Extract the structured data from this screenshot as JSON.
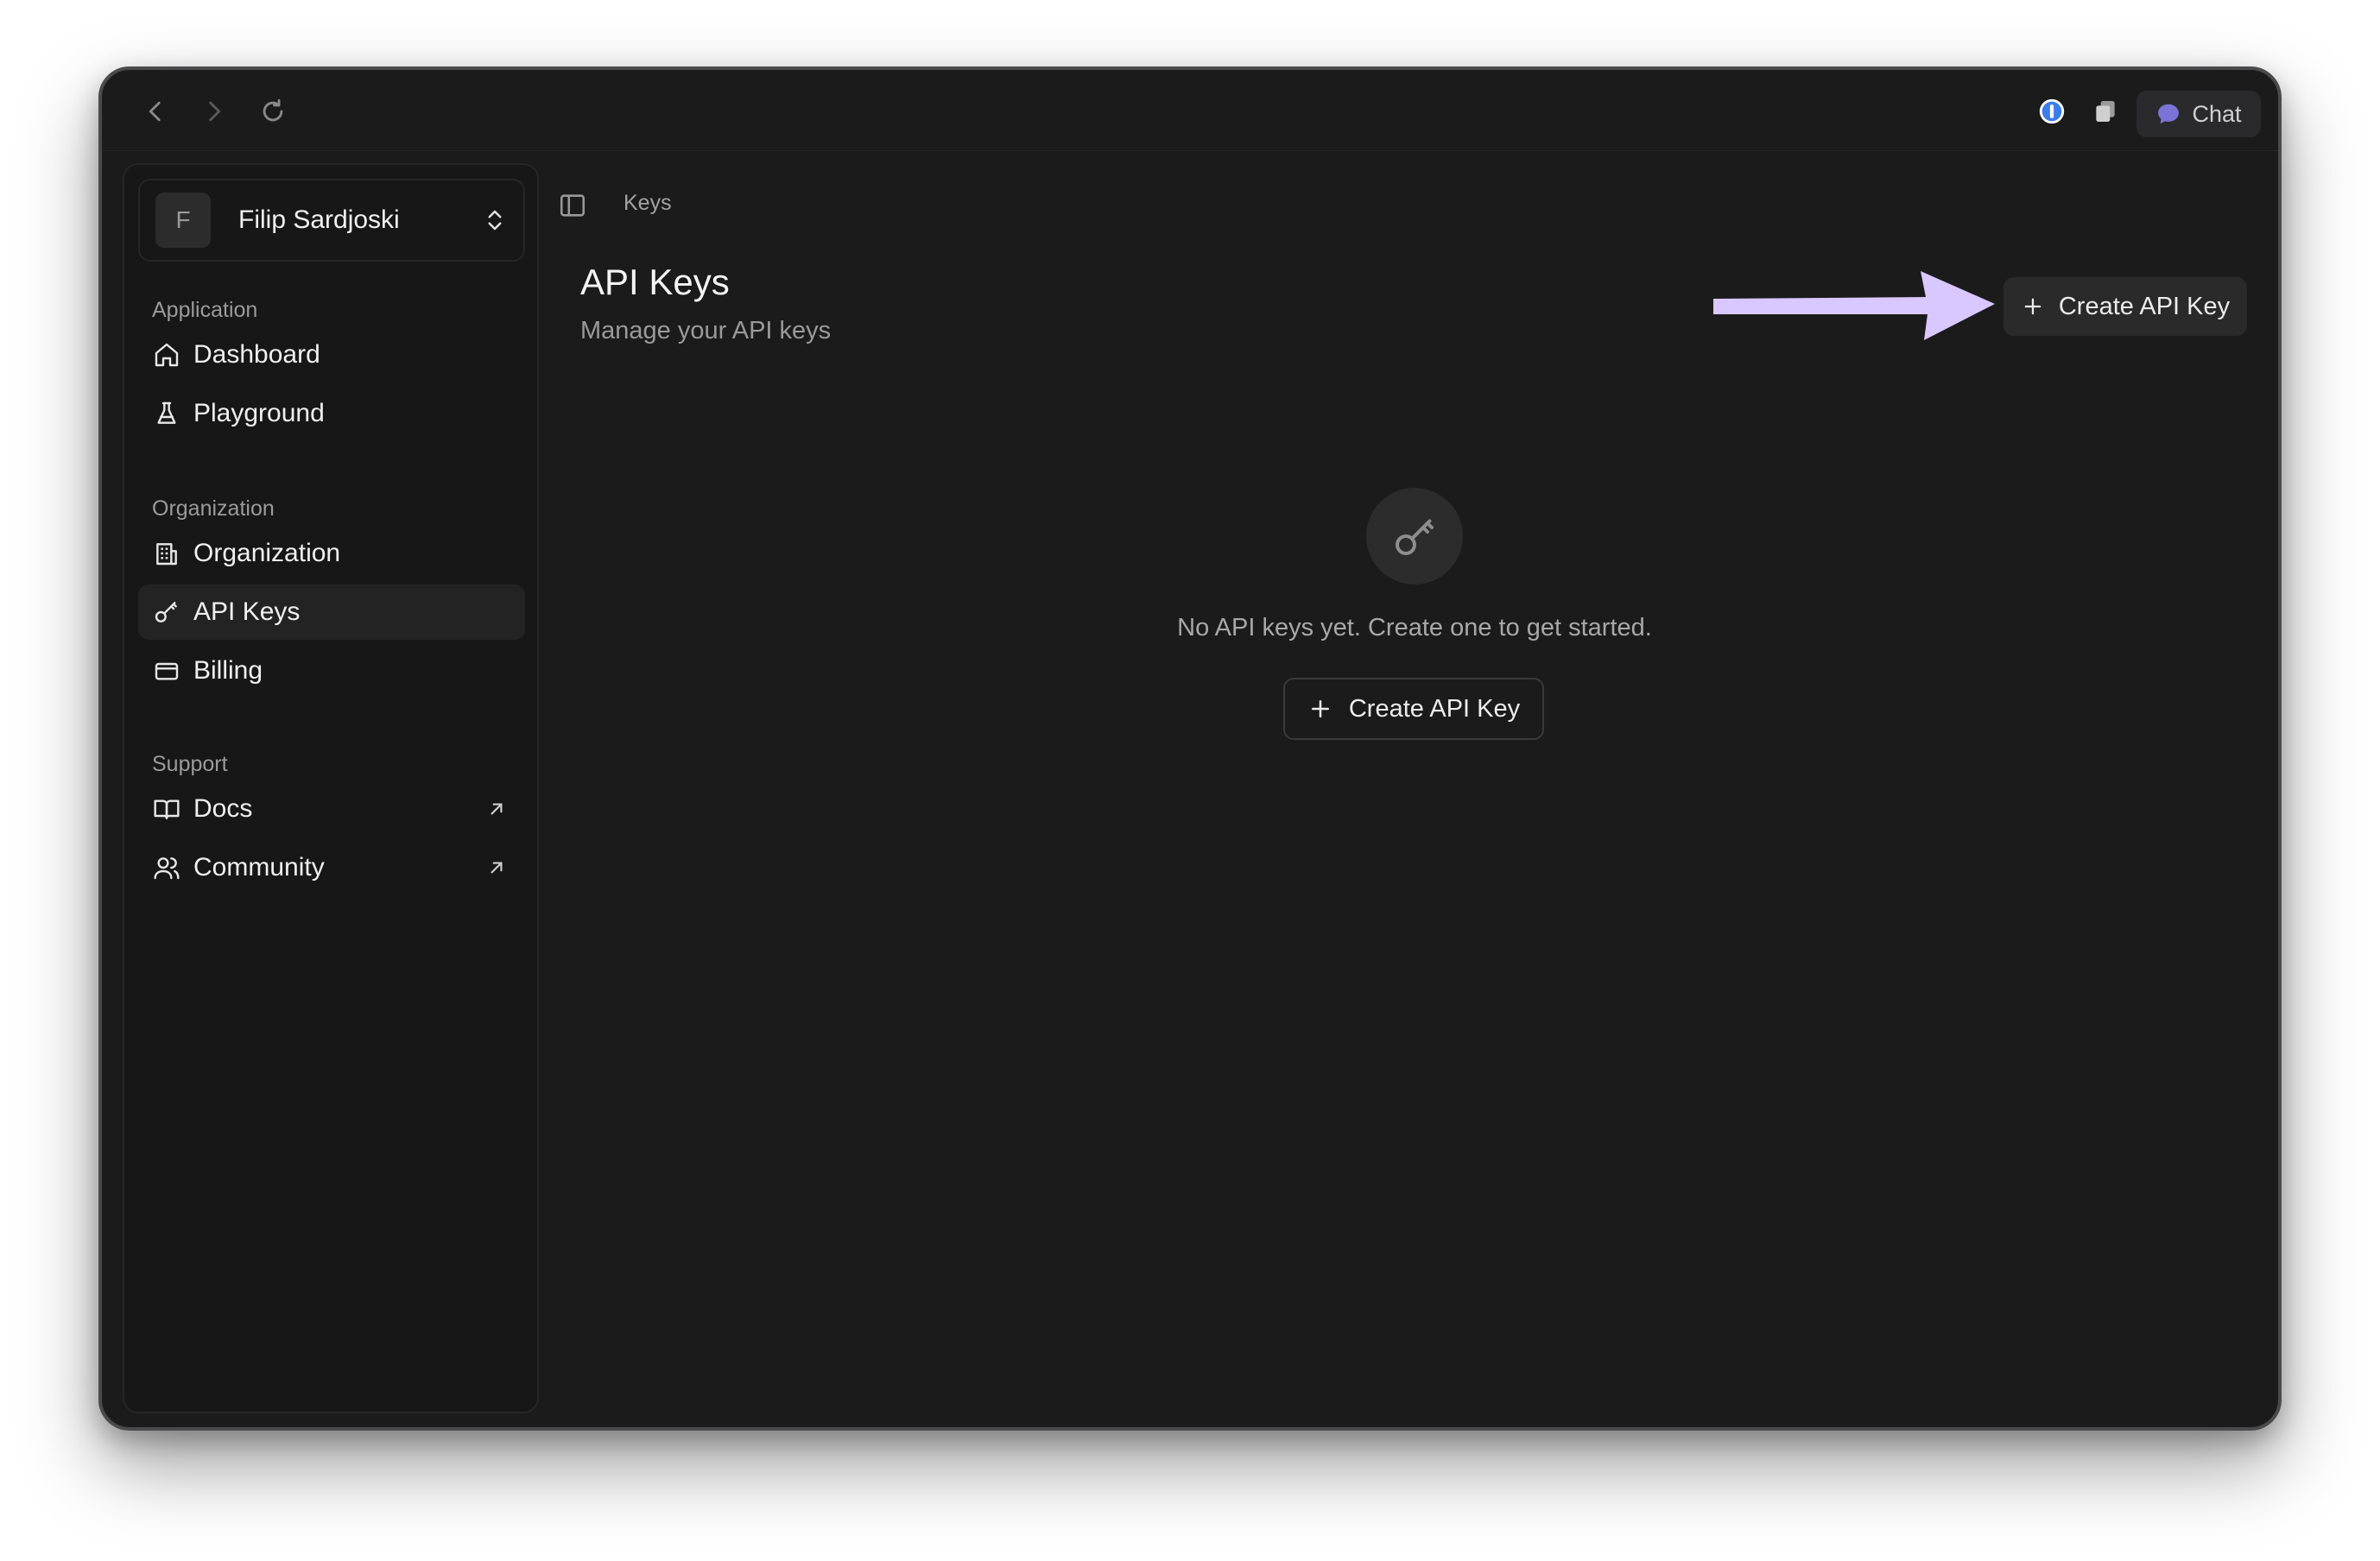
{
  "topbar": {
    "chat_label": "Chat",
    "icons": [
      "back-arrow-icon",
      "forward-arrow-icon",
      "reload-icon",
      "password-manager-icon",
      "copy-icon",
      "chat-bubble-icon"
    ]
  },
  "user": {
    "initial": "F",
    "name": "Filip Sardjoski"
  },
  "sidebar": {
    "sections": [
      {
        "label": "Application",
        "items": [
          {
            "label": "Dashboard",
            "icon": "home-icon"
          },
          {
            "label": "Playground",
            "icon": "flask-icon"
          }
        ]
      },
      {
        "label": "Organization",
        "items": [
          {
            "label": "Organization",
            "icon": "building-icon"
          },
          {
            "label": "API Keys",
            "icon": "key-icon",
            "active": true
          },
          {
            "label": "Billing",
            "icon": "credit-card-icon"
          }
        ]
      },
      {
        "label": "Support",
        "items": [
          {
            "label": "Docs",
            "icon": "book-icon",
            "external": true
          },
          {
            "label": "Community",
            "icon": "users-icon",
            "external": true
          }
        ]
      }
    ]
  },
  "main": {
    "breadcrumb": "Keys",
    "title": "API Keys",
    "subtitle": "Manage your API keys",
    "create_button": "Create API Key",
    "empty_text": "No API keys yet. Create one to get started.",
    "empty_button": "Create API Key"
  },
  "colors": {
    "background": "#1b1b1b",
    "sidebar": "#171717",
    "arrow": "#d9c7ff",
    "accent_info": "#4a9eff"
  }
}
